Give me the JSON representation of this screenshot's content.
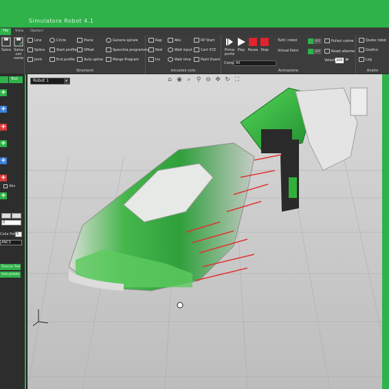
{
  "app": {
    "title": "Simulatore Robot 4.1"
  },
  "ribbon_tabs": [
    "File",
    "Vista",
    "Opzioni"
  ],
  "ribbon": {
    "file_buttons": [
      {
        "label": "Salva",
        "icon": "save-icon"
      },
      {
        "label": "Salva con nome",
        "icon": "save-as-icon"
      }
    ],
    "strumenti": {
      "label": "Strumenti",
      "items": [
        {
          "label": "Line",
          "icon": "line-icon"
        },
        {
          "label": "Circle",
          "icon": "circle-icon"
        },
        {
          "label": "Plane",
          "icon": "plane-icon"
        },
        {
          "label": "Genera spirale",
          "icon": "spiral-icon"
        },
        {
          "label": "Spline",
          "icon": "spline-icon"
        },
        {
          "label": "Start profile",
          "icon": "start-profile-icon"
        },
        {
          "label": "Offset",
          "icon": "offset-icon"
        },
        {
          "label": "Specchia programma",
          "icon": "mirror-icon"
        },
        {
          "label": "Joint",
          "icon": "joint-icon"
        },
        {
          "label": "End profile",
          "icon": "end-profile-icon"
        },
        {
          "label": "Auto spline",
          "icon": "auto-spline-icon"
        },
        {
          "label": "Merge Program",
          "icon": "merge-icon"
        }
      ]
    },
    "istruzioni": {
      "label": "Istruzioni ciclo",
      "items": [
        {
          "label": "Rap",
          "icon": "rapid-icon"
        },
        {
          "label": "Abs",
          "icon": "abs-icon"
        },
        {
          "label": "RP Start",
          "icon": "rp-start-icon"
        },
        {
          "label": "Nod",
          "icon": "node-icon"
        },
        {
          "label": "Wait input",
          "icon": "wait-input-icon"
        },
        {
          "label": "Cart XYZ",
          "icon": "cart-xyz-icon"
        },
        {
          "label": "Inc",
          "icon": "inc-icon"
        },
        {
          "label": "Wait time",
          "icon": "wait-time-icon"
        },
        {
          "label": "Paint Event",
          "icon": "paint-event-icon"
        }
      ]
    },
    "animazione": {
      "label": "Animazione",
      "play_buttons": [
        "Primo punto",
        "Play",
        "Pausa",
        "Stop"
      ],
      "comp_label": "Comp",
      "comp_value": "All",
      "tutti_robot": "Tutti i robot",
      "virtual_paint": "Virtual Paint",
      "off1": "OFF",
      "off2": "OFF",
      "pulisci": "Pulisci colore",
      "reset": "Reset allarme",
      "velocita_label": "Velocità",
      "velocita_value": "100"
    },
    "analisi": {
      "label": "Analisi",
      "items": [
        {
          "label": "Quote robot",
          "icon": "measure-icon"
        },
        {
          "label": "Grafico",
          "icon": "chart-icon"
        },
        {
          "label": "Log",
          "icon": "log-icon"
        }
      ]
    }
  },
  "left_panel": {
    "tab": "Tool",
    "abs_label": "Abs",
    "cella_pot": "Cella Pot",
    "cella_value": "5",
    "input1": "0",
    "anca": "ANC3",
    "btn1": "Tracciar Tool",
    "btn2": "Solo pistola"
  },
  "viewport": {
    "robot_select": "Robot 1"
  },
  "colors": {
    "accent": "#2fb24a",
    "ribbon": "#3c3c3c",
    "panel": "#2d2d2d",
    "viewport": "#c9c9c9"
  }
}
